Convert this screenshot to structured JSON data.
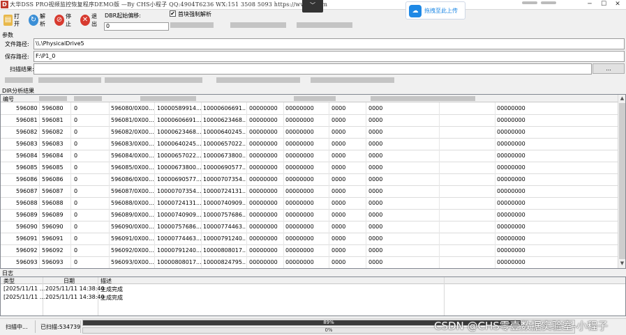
{
  "window": {
    "title": "大华DSS PRO视频监控恢复程序DEMO版 —By CHS小程子 QQ:4904T6236 WX:151 3508 5093  https://www.  .com",
    "upload_badge": "拖拽至此上传"
  },
  "toolbar": {
    "open_label": "打开",
    "parse_label": "解析",
    "stop_label": "停止",
    "exit_label": "退出",
    "dbr_offset_label": "DBR起始偏移:",
    "dbr_offset_value": "0",
    "force_parse_checked": "✔",
    "force_parse_label": "首块强制解析"
  },
  "params": {
    "group_label": "参数",
    "file_path_label": "文件路径:",
    "file_path_value": "\\\\.\\PhysicalDrive5",
    "save_path_label": "保存路径:",
    "save_path_value": "F:\\P1_0",
    "scan_result_label": "扫描结果:",
    "scan_result_value": "",
    "browse_label": "..."
  },
  "dir_table": {
    "title": "DIR分析结果",
    "header": "编号",
    "rows": [
      {
        "c0": "596080",
        "c1": "596080",
        "c2": "0",
        "c3": "596080/0X00...",
        "c4": "10000589914...",
        "c5": "10000606691...",
        "c6": "00000000",
        "c7": "00000000",
        "c8": "0000",
        "c9": "0000",
        "c10": "00000000"
      },
      {
        "c0": "596081",
        "c1": "596081",
        "c2": "0",
        "c3": "596081/0X00...",
        "c4": "10000606691...",
        "c5": "10000623468...",
        "c6": "00000000",
        "c7": "00000000",
        "c8": "0000",
        "c9": "0000",
        "c10": "00000000"
      },
      {
        "c0": "596082",
        "c1": "596082",
        "c2": "0",
        "c3": "596082/0X00...",
        "c4": "10000623468...",
        "c5": "10000640245...",
        "c6": "00000000",
        "c7": "00000000",
        "c8": "0000",
        "c9": "0000",
        "c10": "00000000"
      },
      {
        "c0": "596083",
        "c1": "596083",
        "c2": "0",
        "c3": "596083/0X00...",
        "c4": "10000640245...",
        "c5": "10000657022...",
        "c6": "00000000",
        "c7": "00000000",
        "c8": "0000",
        "c9": "0000",
        "c10": "00000000"
      },
      {
        "c0": "596084",
        "c1": "596084",
        "c2": "0",
        "c3": "596084/0X00...",
        "c4": "10000657022...",
        "c5": "10000673800...",
        "c6": "00000000",
        "c7": "00000000",
        "c8": "0000",
        "c9": "0000",
        "c10": "00000000"
      },
      {
        "c0": "596085",
        "c1": "596085",
        "c2": "0",
        "c3": "596085/0X00...",
        "c4": "10000673800...",
        "c5": "10000690577...",
        "c6": "00000000",
        "c7": "00000000",
        "c8": "0000",
        "c9": "0000",
        "c10": "00000000"
      },
      {
        "c0": "596086",
        "c1": "596086",
        "c2": "0",
        "c3": "596086/0X00...",
        "c4": "10000690577...",
        "c5": "10000707354...",
        "c6": "00000000",
        "c7": "00000000",
        "c8": "0000",
        "c9": "0000",
        "c10": "00000000"
      },
      {
        "c0": "596087",
        "c1": "596087",
        "c2": "0",
        "c3": "596087/0X00...",
        "c4": "10000707354...",
        "c5": "10000724131...",
        "c6": "00000000",
        "c7": "00000000",
        "c8": "0000",
        "c9": "0000",
        "c10": "00000000"
      },
      {
        "c0": "596088",
        "c1": "596088",
        "c2": "0",
        "c3": "596088/0X00...",
        "c4": "10000724131...",
        "c5": "10000740909...",
        "c6": "00000000",
        "c7": "00000000",
        "c8": "0000",
        "c9": "0000",
        "c10": "00000000"
      },
      {
        "c0": "596089",
        "c1": "596089",
        "c2": "0",
        "c3": "596089/0X00...",
        "c4": "10000740909...",
        "c5": "10000757686...",
        "c6": "00000000",
        "c7": "00000000",
        "c8": "0000",
        "c9": "0000",
        "c10": "00000000"
      },
      {
        "c0": "596090",
        "c1": "596090",
        "c2": "0",
        "c3": "596090/0X00...",
        "c4": "10000757686...",
        "c5": "10000774463...",
        "c6": "00000000",
        "c7": "00000000",
        "c8": "0000",
        "c9": "0000",
        "c10": "00000000"
      },
      {
        "c0": "596091",
        "c1": "596091",
        "c2": "0",
        "c3": "596091/0X00...",
        "c4": "10000774463...",
        "c5": "10000791240...",
        "c6": "00000000",
        "c7": "00000000",
        "c8": "0000",
        "c9": "0000",
        "c10": "00000000"
      },
      {
        "c0": "596092",
        "c1": "596092",
        "c2": "0",
        "c3": "596092/0X00...",
        "c4": "10000791240...",
        "c5": "10000808017...",
        "c6": "00000000",
        "c7": "00000000",
        "c8": "0000",
        "c9": "0000",
        "c10": "00000000"
      },
      {
        "c0": "596093",
        "c1": "596093",
        "c2": "0",
        "c3": "596093/0X00...",
        "c4": "10000808017...",
        "c5": "10000824795...",
        "c6": "00000000",
        "c7": "00000000",
        "c8": "0000",
        "c9": "0000",
        "c10": "00000000"
      }
    ]
  },
  "log": {
    "title": "日志",
    "headers": {
      "type": "类型",
      "date": "日期",
      "desc": "描述"
    },
    "rows": [
      {
        "type": "[2025/11/11 ...",
        "date": "2025/11/11 14:38:40",
        "desc": "生成完成"
      },
      {
        "type": "[2025/11/11 ...",
        "date": "2025/11/11 14:38:40",
        "desc": "生成完成"
      }
    ]
  },
  "status": {
    "scan_state": "扫描中...",
    "scanned_count": "已扫描:534739",
    "progress1_text": "89%",
    "progress1_value": 89,
    "progress2_text": "0%",
    "progress2_value": 0,
    "watermark": "CSDN @CHS零壹数据实验室-小程子"
  }
}
